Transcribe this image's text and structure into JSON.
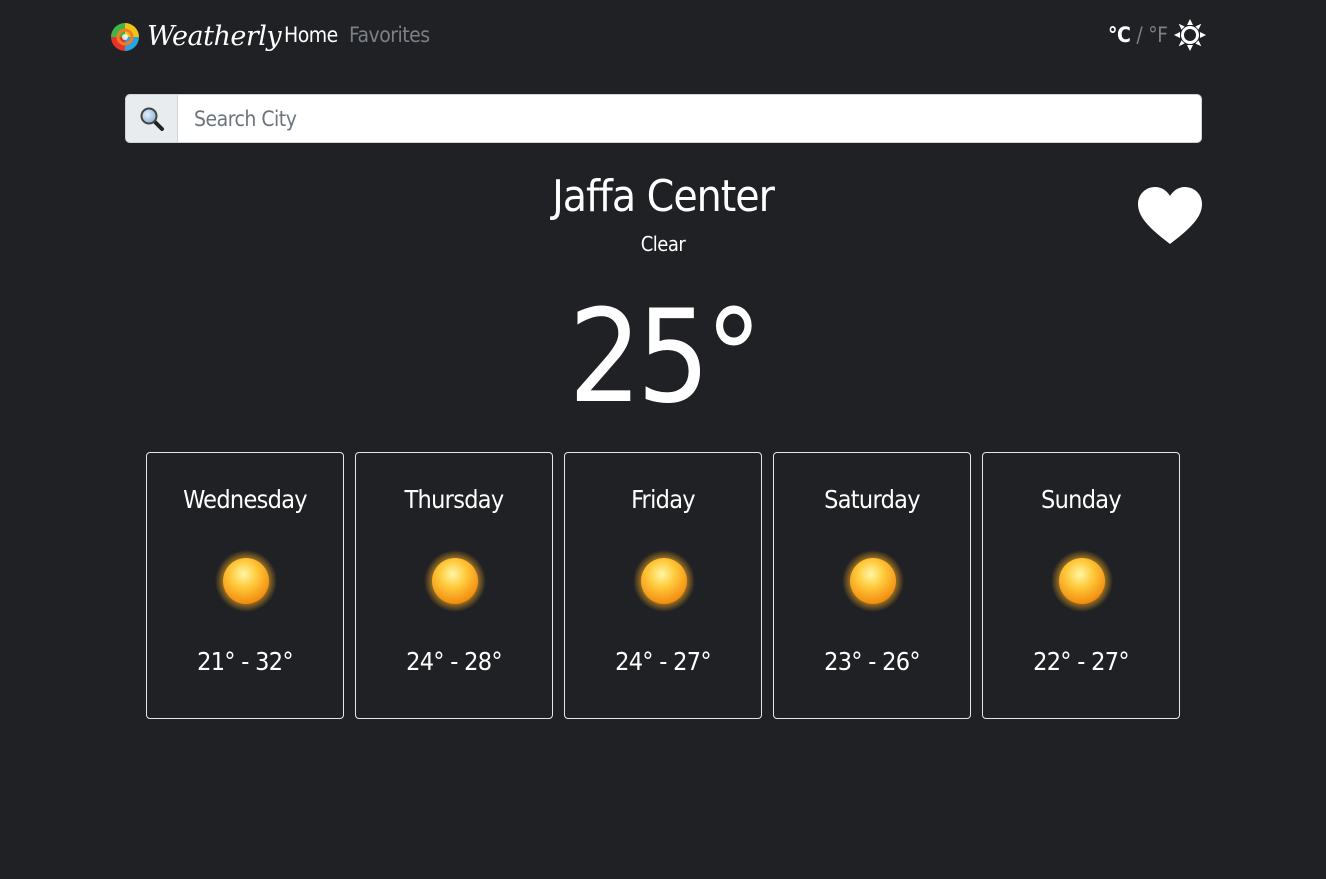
{
  "app": {
    "name": "Weatherly",
    "logo_icon": "rainbow-swirl-logo"
  },
  "nav": {
    "home_label": "Home",
    "favorites_label": "Favorites"
  },
  "units": {
    "celsius": "°C",
    "separator": "/",
    "fahrenheit": "°F",
    "selected": "celsius"
  },
  "theme_toggle": {
    "icon": "sun-icon"
  },
  "search": {
    "icon": "magnifier-icon",
    "placeholder": "Search City",
    "value": ""
  },
  "current": {
    "city": "Jaffa Center",
    "condition": "Clear",
    "temperature": "25°",
    "favorite_icon": "heart-icon"
  },
  "forecast": [
    {
      "day": "Wednesday",
      "icon": "sunny-icon",
      "range": "21° - 32°"
    },
    {
      "day": "Thursday",
      "icon": "sunny-icon",
      "range": "24° - 28°"
    },
    {
      "day": "Friday",
      "icon": "sunny-icon",
      "range": "24° - 27°"
    },
    {
      "day": "Saturday",
      "icon": "sunny-icon",
      "range": "23° - 26°"
    },
    {
      "day": "Sunday",
      "icon": "sunny-icon",
      "range": "22° - 27°"
    }
  ],
  "colors": {
    "background": "#1f2124",
    "text": "#ffffff",
    "muted": "#7b8087",
    "card_border": "#e6e6e6",
    "search_addon": "#e9ecef"
  }
}
